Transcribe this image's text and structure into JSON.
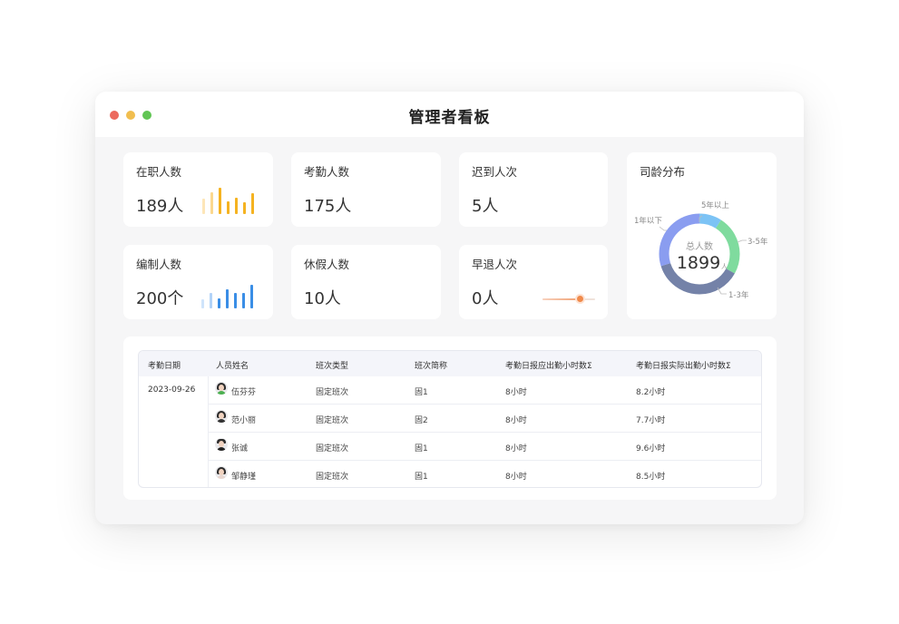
{
  "window": {
    "title": "管理者看板"
  },
  "stats": {
    "employees": {
      "label": "在职人数",
      "value": "189人"
    },
    "attendance": {
      "label": "考勤人数",
      "value": "175人"
    },
    "late": {
      "label": "迟到人次",
      "value": "5人"
    },
    "headcount": {
      "label": "编制人数",
      "value": "200个"
    },
    "leave": {
      "label": "休假人数",
      "value": "10人"
    },
    "early_leave": {
      "label": "早退人次",
      "value": "0人",
      "slider_level": 0.7
    }
  },
  "tenure": {
    "label": "司龄分布",
    "center_label": "总人数",
    "center_value": "1899",
    "center_unit": "人",
    "segments": [
      {
        "name": "5年以上",
        "color": "#7cc3f5",
        "share": 0.09
      },
      {
        "name": "3-5年",
        "color": "#7fdb9e",
        "share": 0.24
      },
      {
        "name": "1-3年",
        "color": "#7482a8",
        "share": 0.37
      },
      {
        "name": "1年以下",
        "color": "#8a9df0",
        "share": 0.3
      }
    ]
  },
  "colors": {
    "yellow_bars": [
      "#fde6b8",
      "#fbd88f",
      "#f5b321",
      "#f5b321",
      "#f5b321",
      "#f5b321",
      "#f5b321"
    ],
    "blue_bars": [
      "#cfe4fb",
      "#b2d3f8",
      "#3a8ee6",
      "#3a8ee6",
      "#3a8ee6",
      "#3a8ee6",
      "#3a8ee6"
    ]
  },
  "table": {
    "headers": [
      "考勤日期",
      "人员姓名",
      "班次类型",
      "班次简称",
      "考勤日报应出勤小时数Σ",
      "考勤日报实际出勤小时数Σ"
    ],
    "date": "2023-09-26",
    "rows": [
      {
        "name": "伍芬芬",
        "shift_type": "固定班次",
        "shift_short": "固1",
        "planned": "8小时",
        "actual": "8.2小时",
        "avatar": "green"
      },
      {
        "name": "范小丽",
        "shift_type": "固定班次",
        "shift_short": "固2",
        "planned": "8小时",
        "actual": "7.7小时",
        "avatar": "dark"
      },
      {
        "name": "张诚",
        "shift_type": "固定班次",
        "shift_short": "固1",
        "planned": "8小时",
        "actual": "9.6小时",
        "avatar": "suit"
      },
      {
        "name": "邹静瑾",
        "shift_type": "固定班次",
        "shift_short": "固1",
        "planned": "8小时",
        "actual": "8.5小时",
        "avatar": "light"
      }
    ]
  }
}
